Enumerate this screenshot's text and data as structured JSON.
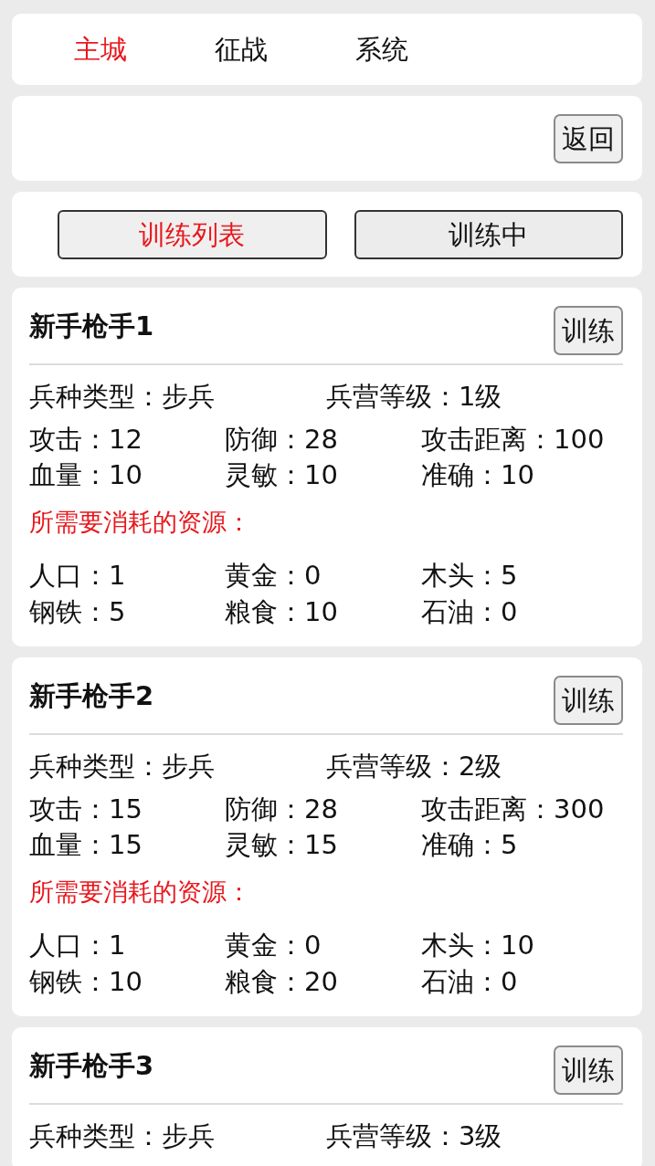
{
  "nav_tabs": [
    {
      "label": "主城",
      "selected": true
    },
    {
      "label": "征战",
      "selected": false
    },
    {
      "label": "系统",
      "selected": false
    }
  ],
  "toolbar": {
    "back_button": "返回"
  },
  "sub_tabs": [
    {
      "label": "训练列表",
      "selected": true
    },
    {
      "label": "训练中",
      "selected": false
    }
  ],
  "units": [
    {
      "name": "新手枪手1",
      "train_button": "训练",
      "info": [
        "兵种类型：步兵",
        "兵营等级：1级"
      ],
      "stats": [
        "攻击：12",
        "防御：28",
        "攻击距离：100",
        "血量：10",
        "灵敏：10",
        "准确：10"
      ],
      "cost_heading": "所需要消耗的资源：",
      "costs": [
        "人口：1",
        "黄金：0",
        "木头：5",
        "钢铁：5",
        "粮食：10",
        "石油：0"
      ]
    },
    {
      "name": "新手枪手2",
      "train_button": "训练",
      "info": [
        "兵种类型：步兵",
        "兵营等级：2级"
      ],
      "stats": [
        "攻击：15",
        "防御：28",
        "攻击距离：300",
        "血量：15",
        "灵敏：15",
        "准确：5"
      ],
      "cost_heading": "所需要消耗的资源：",
      "costs": [
        "人口：1",
        "黄金：0",
        "木头：10",
        "钢铁：10",
        "粮食：20",
        "石油：0"
      ]
    },
    {
      "name": "新手枪手3",
      "train_button": "训练",
      "info": [
        "兵种类型：步兵",
        "兵营等级：3级"
      ]
    }
  ]
}
